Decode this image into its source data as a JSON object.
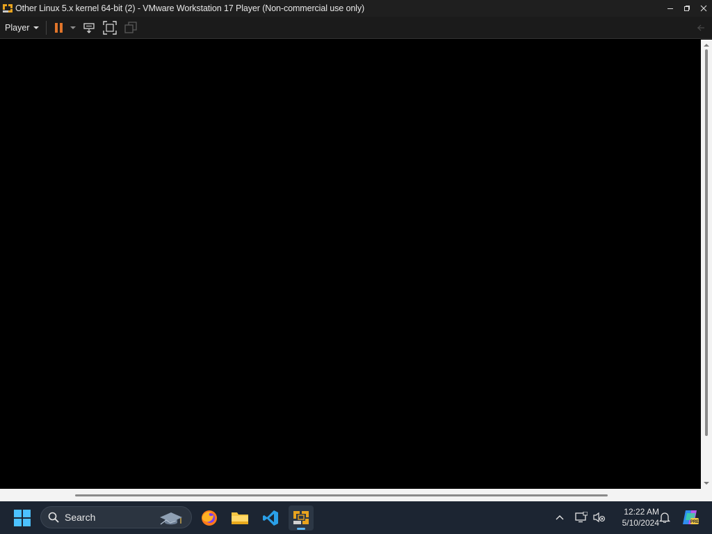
{
  "window": {
    "title": "Other Linux 5.x kernel 64-bit (2) - VMware Workstation 17 Player (Non-commercial use only)",
    "controls": [
      "minimize-icon",
      "restore-icon",
      "close-icon"
    ]
  },
  "toolbar": {
    "player_label": "Player",
    "buttons": [
      "pause-icon",
      "send-ctrl-alt-del-icon",
      "full-screen-icon",
      "unity-icon"
    ],
    "accent": "#e0742a"
  },
  "console": {
    "background": "#000000"
  },
  "taskbar": {
    "search_placeholder": "Search",
    "apps": [
      "firefox-icon",
      "file-explorer-icon",
      "vscode-icon",
      "vmware-player-icon"
    ],
    "active_app": "vmware-player-icon",
    "tray_icons": [
      "chevron-up-icon",
      "display-icon",
      "volume-muted-icon",
      "notification-bell-icon",
      "copilot-icon"
    ],
    "clock": {
      "time": "12:22 AM",
      "date": "5/10/2024"
    }
  }
}
